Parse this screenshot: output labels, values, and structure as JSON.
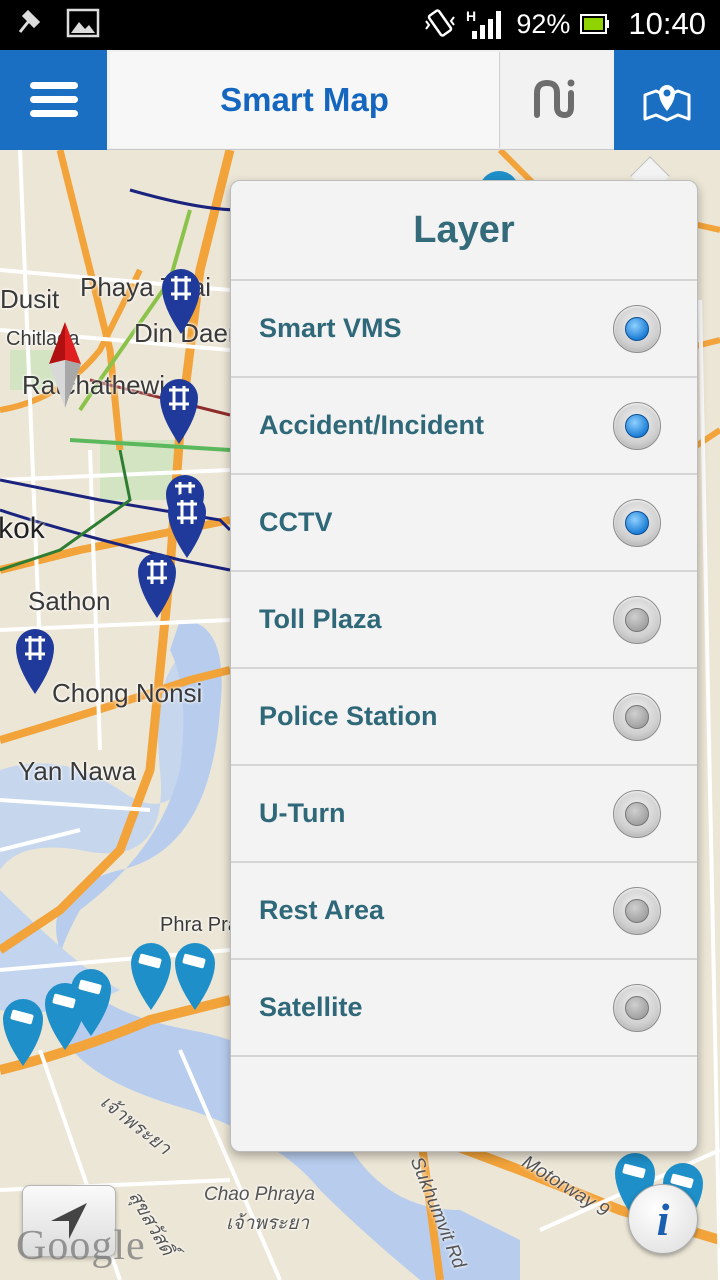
{
  "status_bar": {
    "battery": "92%",
    "time": "10:40",
    "signal_type": "H"
  },
  "header": {
    "title": "Smart Map",
    "menu_icon": "hamburger-menu-icon",
    "mid_icon": "nu-logo-icon",
    "layers_icon": "map-pin-icon"
  },
  "map": {
    "places": [
      "Dusit",
      "Phaya Thai",
      "Din Daeng",
      "Chitlada",
      "Ratchathewi",
      "Bangkok",
      "Sathon",
      "Chong Nonsi",
      "Yan Nawa",
      "Phra Pradaeng",
      "Chao Phraya",
      "เจ้าพระยา",
      "เจ้าพระยา",
      "สุขสวัสดิ์",
      "Sukhumvit Rd",
      "Motorway 9"
    ],
    "attribution": "Google"
  },
  "layer_popup": {
    "title": "Layer",
    "items": [
      {
        "label": "Smart VMS",
        "checked": true
      },
      {
        "label": "Accident/Incident",
        "checked": true
      },
      {
        "label": "CCTV",
        "checked": true
      },
      {
        "label": "Toll Plaza",
        "checked": false
      },
      {
        "label": "Police Station",
        "checked": false
      },
      {
        "label": "U-Turn",
        "checked": false
      },
      {
        "label": "Rest Area",
        "checked": false
      },
      {
        "label": "Satellite",
        "checked": false
      }
    ]
  },
  "controls": {
    "locate_icon": "navigation-arrow-icon",
    "info_icon": "info-icon",
    "info_label": "i"
  },
  "colors": {
    "header_blue": "#1a6fc2",
    "title_blue": "#1466bf",
    "layer_text": "#2f6878",
    "radio_on": "#1d7fd6"
  }
}
